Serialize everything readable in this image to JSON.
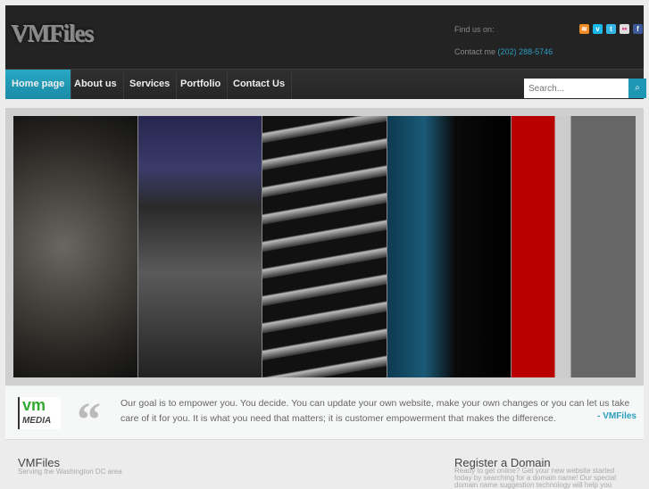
{
  "header": {
    "logo": "VMFiles",
    "find_us": "Find us on:",
    "contact_label": "Contact me",
    "phone": "(202) 288-5746",
    "social": [
      {
        "name": "rss",
        "glyph": "☰",
        "color": "#f08a24"
      },
      {
        "name": "vimeo",
        "glyph": "v",
        "color": "#1ab7ea"
      },
      {
        "name": "twitter",
        "glyph": "t",
        "color": "#33b5e5"
      },
      {
        "name": "flickr",
        "glyph": "••",
        "color": "#ddd"
      },
      {
        "name": "facebook",
        "glyph": "f",
        "color": "#3b5998"
      }
    ]
  },
  "nav": {
    "items": [
      "Home page",
      "About us",
      "Services",
      "Portfolio",
      "Contact Us"
    ],
    "search_placeholder": "Search...",
    "search_icon": "⌕"
  },
  "quote": {
    "logo_top": "vm",
    "logo_bottom": "MEDIA",
    "mark": "“",
    "text": "Our goal is to empower you. You decide. You can update your own website, make your own changes or you can let us take care of it for you. It is what you need that matters; it is customer empowerment that makes the difference.",
    "author": "- VMFiles"
  },
  "footer": {
    "left_title": "VMFiles",
    "left_sub": "Serving the Washington DC area",
    "right_title": "Register a Domain",
    "right_text": "Ready to get online? Get your new website started today by searching for a domain name! Our special domain name suggestion technology will help you"
  }
}
